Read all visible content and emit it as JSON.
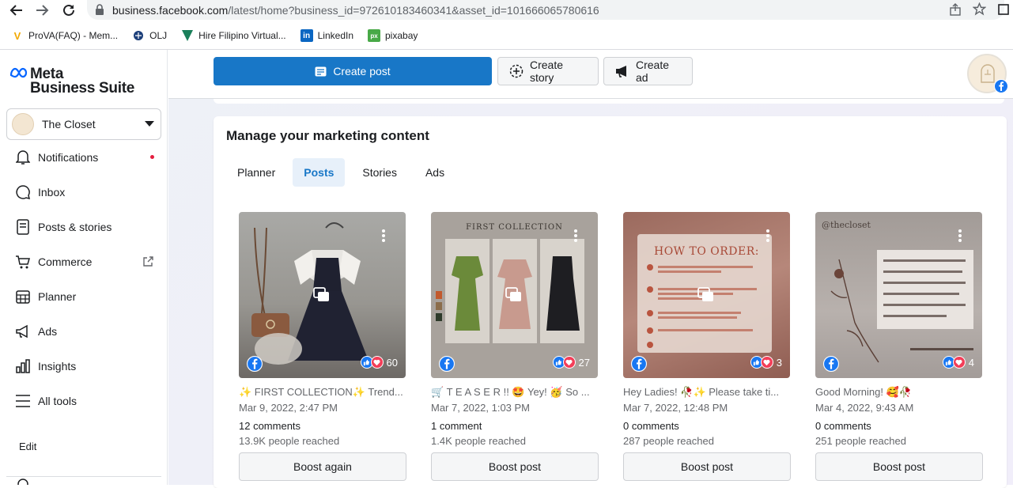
{
  "browser": {
    "url_host": "business.facebook.com",
    "url_path": "/latest/home?business_id=972610183460341&asset_id=101666065780616",
    "bookmarks": [
      {
        "label": "ProVA(FAQ) - Mem...",
        "icon": "prova-icon",
        "color": "#f2a900"
      },
      {
        "label": "OLJ",
        "icon": "olj-icon",
        "color": "#1c3f7a"
      },
      {
        "label": "Hire Filipino Virtual...",
        "icon": "hire-filipino-icon",
        "color": "#1a7f5a"
      },
      {
        "label": "LinkedIn",
        "icon": "linkedin-icon",
        "color": "#0a66c2"
      },
      {
        "label": "pixabay",
        "icon": "pixabay-icon",
        "color": "#48a947"
      }
    ]
  },
  "sidebar": {
    "logo_line1": "Meta",
    "logo_line2": "Business Suite",
    "account": "The Closet",
    "items": [
      {
        "label": "Notifications",
        "icon": "bell-icon"
      },
      {
        "label": "Inbox",
        "icon": "chat-bubble-icon"
      },
      {
        "label": "Posts & stories",
        "icon": "posts-icon"
      },
      {
        "label": "Commerce",
        "icon": "cart-icon"
      },
      {
        "label": "Planner",
        "icon": "calendar-icon"
      },
      {
        "label": "Ads",
        "icon": "megaphone-icon"
      },
      {
        "label": "Insights",
        "icon": "bar-chart-icon"
      },
      {
        "label": "All tools",
        "icon": "menu-icon"
      }
    ],
    "edit_label": "Edit"
  },
  "topbar": {
    "create_post": "Create post",
    "create_story": "Create story",
    "create_ad": "Create ad"
  },
  "content": {
    "title": "Manage your marketing content",
    "tabs": [
      "Planner",
      "Posts",
      "Stories",
      "Ads"
    ],
    "active_tab": "Posts",
    "posts": [
      {
        "caption": "✨ FIRST COLLECTION✨ Trend...",
        "date": "Mar 9, 2022, 2:47 PM",
        "comments": "12 comments",
        "reach": "13.9K people reached",
        "reactions": "60",
        "button": "Boost again",
        "thumb_label": ""
      },
      {
        "caption": "🛒 T E A S E R !! 🤩 Yey! 🥳 So ...",
        "date": "Mar 7, 2022, 1:03 PM",
        "comments": "1 comment",
        "reach": "1.4K people reached",
        "reactions": "27",
        "button": "Boost post",
        "thumb_label": "FIRST COLLECTION"
      },
      {
        "caption": "Hey Ladies! 🥀✨ Please take ti...",
        "date": "Mar 7, 2022, 12:48 PM",
        "comments": "0 comments",
        "reach": "287 people reached",
        "reactions": "3",
        "button": "Boost post",
        "thumb_label": "HOW TO ORDER:"
      },
      {
        "caption": "Good Morning! 🥰🥀",
        "date": "Mar 4, 2022, 9:43 AM",
        "comments": "0 comments",
        "reach": "251 people reached",
        "reactions": "4",
        "button": "Boost post",
        "thumb_label": "@thecloset"
      }
    ]
  }
}
